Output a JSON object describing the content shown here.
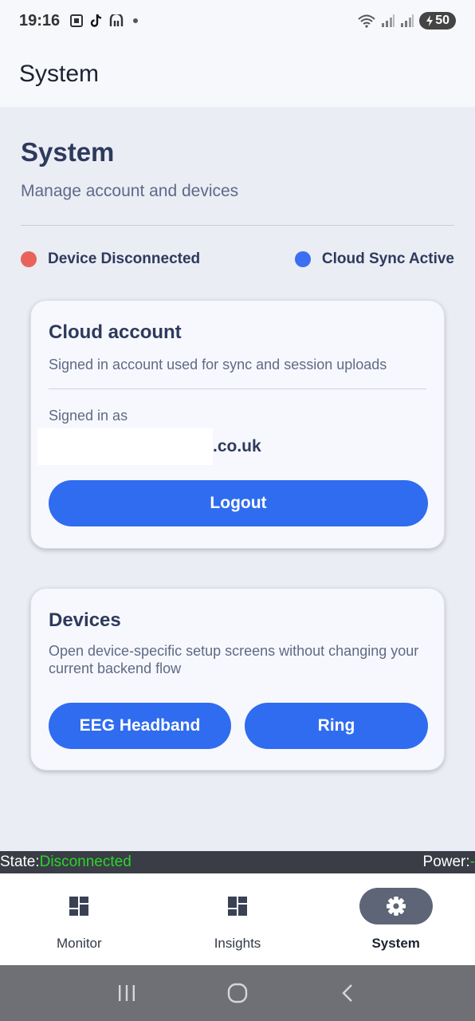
{
  "status_bar": {
    "time": "19:16",
    "battery": "50",
    "icons_left": [
      "screenshot-icon",
      "tiktok-icon",
      "app-m-icon",
      "dot-icon"
    ],
    "icons_right": [
      "wifi-icon",
      "signal-icon",
      "signal-icon",
      "battery-icon"
    ]
  },
  "app_bar": {
    "title": "System"
  },
  "header": {
    "title": "System",
    "subtitle": "Manage account and devices"
  },
  "status_row": {
    "device": {
      "label": "Device Disconnected",
      "color": "#e8645a"
    },
    "cloud": {
      "label": "Cloud Sync Active",
      "color": "#3b6ef0"
    }
  },
  "account_card": {
    "title": "Cloud account",
    "description": "Signed in account used for sync and session uploads",
    "signed_in_label": "Signed in as",
    "email_visible_suffix": ".co.uk",
    "logout_label": "Logout"
  },
  "devices_card": {
    "title": "Devices",
    "description": "Open device-specific setup screens without changing your current backend flow",
    "eeg_label": "EEG Headband",
    "ring_label": "Ring"
  },
  "debug_bar": {
    "state_label": "State:",
    "state_value": "Disconnected",
    "power_label": "Power:",
    "power_value": "-"
  },
  "bottom_nav": {
    "items": [
      {
        "label": "Monitor",
        "icon": "dashboard-icon",
        "active": false
      },
      {
        "label": "Insights",
        "icon": "dashboard-icon",
        "active": false
      },
      {
        "label": "System",
        "icon": "gear-icon",
        "active": true
      }
    ]
  },
  "colors": {
    "accent": "#2f6cf0",
    "background": "#ebedf5",
    "card": "#f7f8fd",
    "state_ok": "#2bd42b"
  }
}
